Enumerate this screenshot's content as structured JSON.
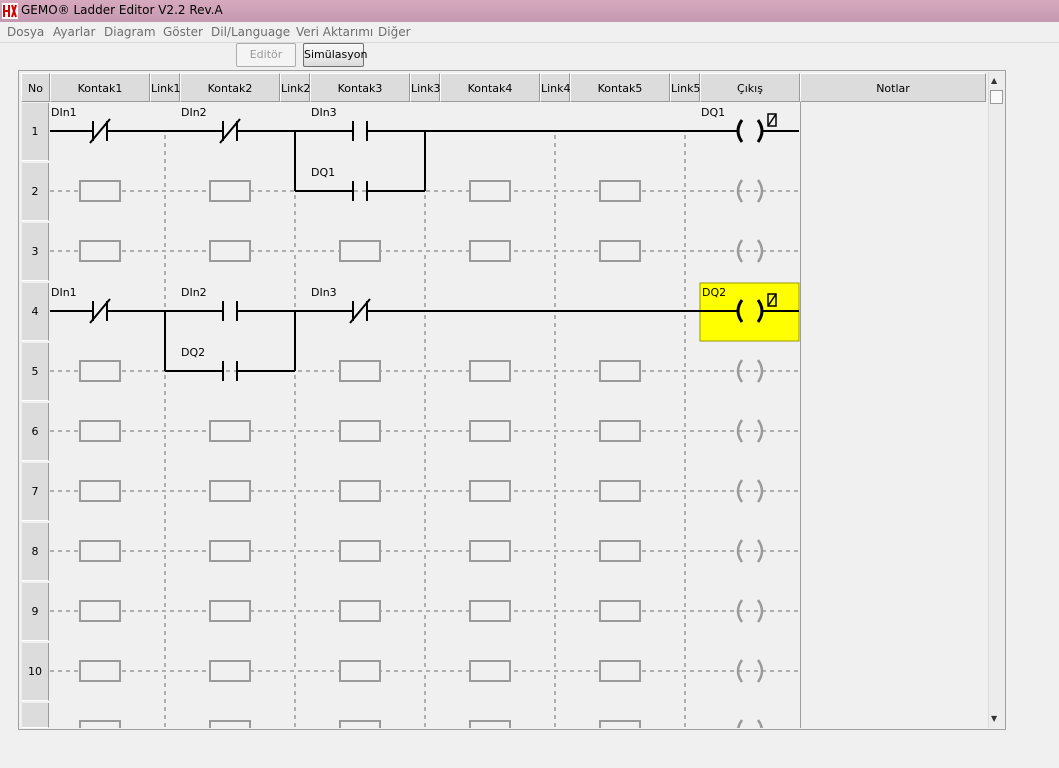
{
  "window": {
    "title": "GEMO® Ladder Editor V2.2 Rev.A"
  },
  "menu": [
    "Dosya",
    "Ayarlar",
    "Diagram",
    "Göster",
    "Dil/Language",
    "Veri Aktarımı",
    "Diğer"
  ],
  "toolbar": {
    "editor_label": "Editör",
    "simulation_label": "Simülasyon"
  },
  "grid": {
    "headers": [
      "No",
      "Kontak1",
      "Link1",
      "Kontak2",
      "Link2",
      "Kontak3",
      "Link3",
      "Kontak4",
      "Link4",
      "Kontak5",
      "Link5",
      "Çıkış",
      "Notlar"
    ],
    "row_numbers": [
      "1",
      "2",
      "3",
      "4",
      "5",
      "6",
      "7",
      "8",
      "9",
      "10"
    ],
    "rung1": {
      "contact1_label": "DIn1",
      "contact2_label": "DIn2",
      "contact3_label": "DIn3",
      "parallel_label": "DQ1",
      "coil_label": "DQ1"
    },
    "rung4": {
      "contact1_label": "DIn1",
      "contact2_label": "DIn2",
      "contact3_label": "DIn3",
      "parallel_label": "DQ2",
      "coil_label": "DQ2",
      "coil_highlight": "#ffff00"
    }
  }
}
